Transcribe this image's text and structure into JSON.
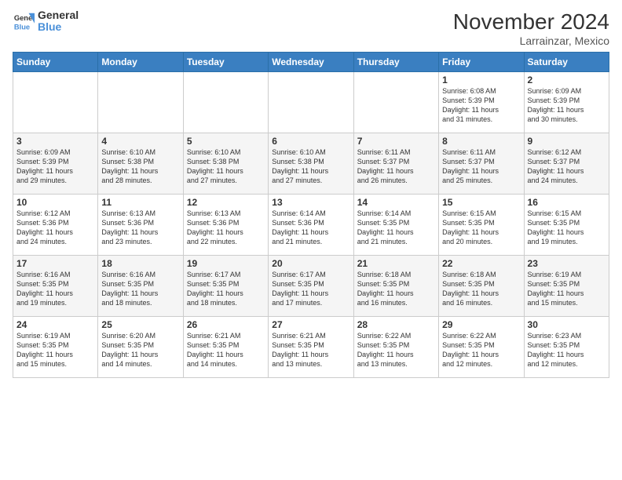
{
  "logo": {
    "line1": "General",
    "line2": "Blue"
  },
  "title": "November 2024",
  "subtitle": "Larrainzar, Mexico",
  "days_of_week": [
    "Sunday",
    "Monday",
    "Tuesday",
    "Wednesday",
    "Thursday",
    "Friday",
    "Saturday"
  ],
  "weeks": [
    [
      {
        "day": "",
        "info": ""
      },
      {
        "day": "",
        "info": ""
      },
      {
        "day": "",
        "info": ""
      },
      {
        "day": "",
        "info": ""
      },
      {
        "day": "",
        "info": ""
      },
      {
        "day": "1",
        "info": "Sunrise: 6:08 AM\nSunset: 5:39 PM\nDaylight: 11 hours\nand 31 minutes."
      },
      {
        "day": "2",
        "info": "Sunrise: 6:09 AM\nSunset: 5:39 PM\nDaylight: 11 hours\nand 30 minutes."
      }
    ],
    [
      {
        "day": "3",
        "info": "Sunrise: 6:09 AM\nSunset: 5:39 PM\nDaylight: 11 hours\nand 29 minutes."
      },
      {
        "day": "4",
        "info": "Sunrise: 6:10 AM\nSunset: 5:38 PM\nDaylight: 11 hours\nand 28 minutes."
      },
      {
        "day": "5",
        "info": "Sunrise: 6:10 AM\nSunset: 5:38 PM\nDaylight: 11 hours\nand 27 minutes."
      },
      {
        "day": "6",
        "info": "Sunrise: 6:10 AM\nSunset: 5:38 PM\nDaylight: 11 hours\nand 27 minutes."
      },
      {
        "day": "7",
        "info": "Sunrise: 6:11 AM\nSunset: 5:37 PM\nDaylight: 11 hours\nand 26 minutes."
      },
      {
        "day": "8",
        "info": "Sunrise: 6:11 AM\nSunset: 5:37 PM\nDaylight: 11 hours\nand 25 minutes."
      },
      {
        "day": "9",
        "info": "Sunrise: 6:12 AM\nSunset: 5:37 PM\nDaylight: 11 hours\nand 24 minutes."
      }
    ],
    [
      {
        "day": "10",
        "info": "Sunrise: 6:12 AM\nSunset: 5:36 PM\nDaylight: 11 hours\nand 24 minutes."
      },
      {
        "day": "11",
        "info": "Sunrise: 6:13 AM\nSunset: 5:36 PM\nDaylight: 11 hours\nand 23 minutes."
      },
      {
        "day": "12",
        "info": "Sunrise: 6:13 AM\nSunset: 5:36 PM\nDaylight: 11 hours\nand 22 minutes."
      },
      {
        "day": "13",
        "info": "Sunrise: 6:14 AM\nSunset: 5:36 PM\nDaylight: 11 hours\nand 21 minutes."
      },
      {
        "day": "14",
        "info": "Sunrise: 6:14 AM\nSunset: 5:35 PM\nDaylight: 11 hours\nand 21 minutes."
      },
      {
        "day": "15",
        "info": "Sunrise: 6:15 AM\nSunset: 5:35 PM\nDaylight: 11 hours\nand 20 minutes."
      },
      {
        "day": "16",
        "info": "Sunrise: 6:15 AM\nSunset: 5:35 PM\nDaylight: 11 hours\nand 19 minutes."
      }
    ],
    [
      {
        "day": "17",
        "info": "Sunrise: 6:16 AM\nSunset: 5:35 PM\nDaylight: 11 hours\nand 19 minutes."
      },
      {
        "day": "18",
        "info": "Sunrise: 6:16 AM\nSunset: 5:35 PM\nDaylight: 11 hours\nand 18 minutes."
      },
      {
        "day": "19",
        "info": "Sunrise: 6:17 AM\nSunset: 5:35 PM\nDaylight: 11 hours\nand 18 minutes."
      },
      {
        "day": "20",
        "info": "Sunrise: 6:17 AM\nSunset: 5:35 PM\nDaylight: 11 hours\nand 17 minutes."
      },
      {
        "day": "21",
        "info": "Sunrise: 6:18 AM\nSunset: 5:35 PM\nDaylight: 11 hours\nand 16 minutes."
      },
      {
        "day": "22",
        "info": "Sunrise: 6:18 AM\nSunset: 5:35 PM\nDaylight: 11 hours\nand 16 minutes."
      },
      {
        "day": "23",
        "info": "Sunrise: 6:19 AM\nSunset: 5:35 PM\nDaylight: 11 hours\nand 15 minutes."
      }
    ],
    [
      {
        "day": "24",
        "info": "Sunrise: 6:19 AM\nSunset: 5:35 PM\nDaylight: 11 hours\nand 15 minutes."
      },
      {
        "day": "25",
        "info": "Sunrise: 6:20 AM\nSunset: 5:35 PM\nDaylight: 11 hours\nand 14 minutes."
      },
      {
        "day": "26",
        "info": "Sunrise: 6:21 AM\nSunset: 5:35 PM\nDaylight: 11 hours\nand 14 minutes."
      },
      {
        "day": "27",
        "info": "Sunrise: 6:21 AM\nSunset: 5:35 PM\nDaylight: 11 hours\nand 13 minutes."
      },
      {
        "day": "28",
        "info": "Sunrise: 6:22 AM\nSunset: 5:35 PM\nDaylight: 11 hours\nand 13 minutes."
      },
      {
        "day": "29",
        "info": "Sunrise: 6:22 AM\nSunset: 5:35 PM\nDaylight: 11 hours\nand 12 minutes."
      },
      {
        "day": "30",
        "info": "Sunrise: 6:23 AM\nSunset: 5:35 PM\nDaylight: 11 hours\nand 12 minutes."
      }
    ]
  ]
}
